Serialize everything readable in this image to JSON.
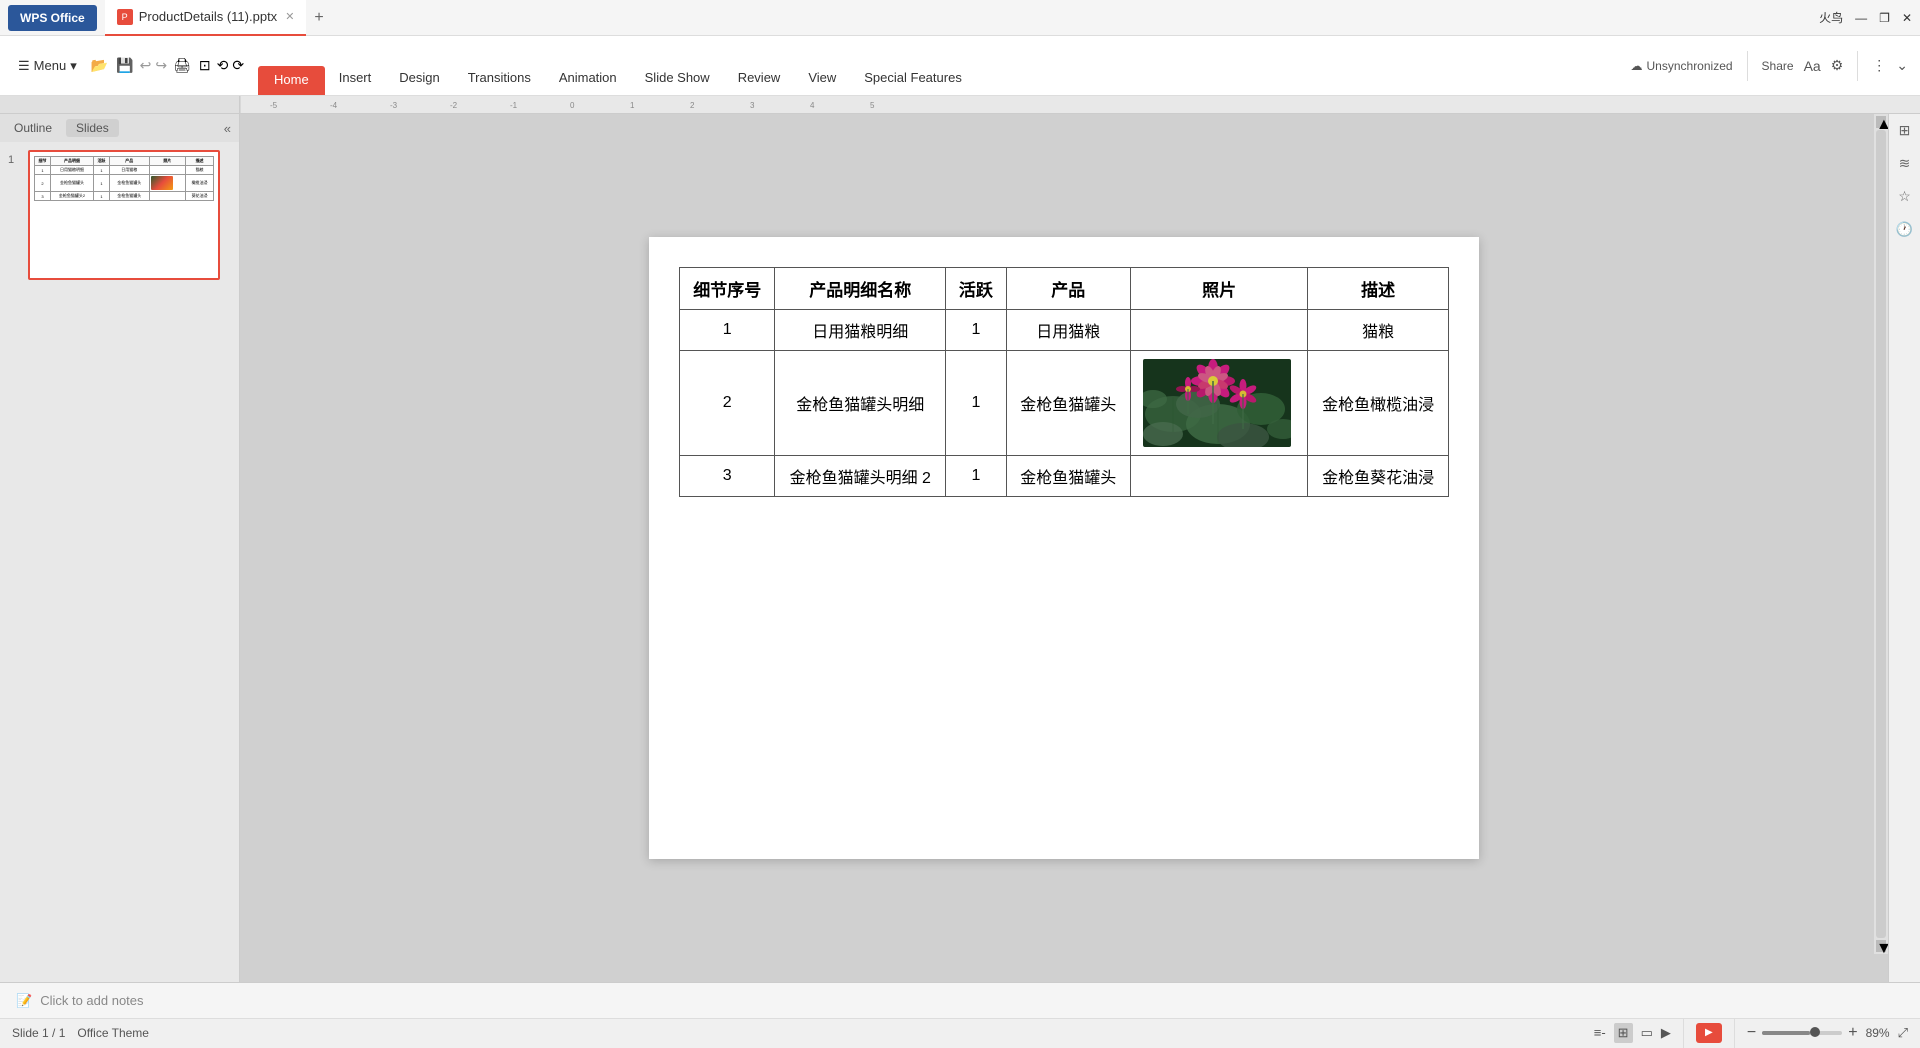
{
  "titleBar": {
    "wpsLabel": "WPS Office",
    "fileName": "ProductDetails (11).pptx",
    "addTabLabel": "+",
    "firebird": "火鸟",
    "unsync": "Unsynchronized",
    "share": "Share",
    "windowControls": [
      "—",
      "❐",
      "✕"
    ]
  },
  "ribbon": {
    "menu": "Menu",
    "tabs": [
      {
        "label": "Home",
        "active": true,
        "style": "home"
      },
      {
        "label": "Insert",
        "active": false
      },
      {
        "label": "Design",
        "active": false
      },
      {
        "label": "Transitions",
        "active": false
      },
      {
        "label": "Animation",
        "active": false
      },
      {
        "label": "Slide Show",
        "active": false
      },
      {
        "label": "Review",
        "active": false
      },
      {
        "label": "View",
        "active": false
      },
      {
        "label": "Special Features",
        "active": false
      }
    ]
  },
  "leftPanel": {
    "tabs": [
      {
        "label": "Outline"
      },
      {
        "label": "Slides",
        "active": true
      }
    ],
    "collapseIcon": "«"
  },
  "slide": {
    "table": {
      "headers": [
        "细节序号",
        "产品明细名称",
        "活跃",
        "产品",
        "照片",
        "描述"
      ],
      "rows": [
        {
          "id": "1",
          "name": "日用猫粮明细",
          "active": "1",
          "product": "日用猫粮",
          "photo": "",
          "description": "猫粮"
        },
        {
          "id": "2",
          "name": "金枪鱼猫罐头明细",
          "active": "1",
          "product": "金枪鱼猫罐头",
          "photo": "lotus",
          "description": "金枪鱼橄榄油浸"
        },
        {
          "id": "3",
          "name": "金枪鱼猫罐头明细 2",
          "active": "1",
          "product": "金枪鱼猫罐头",
          "photo": "",
          "description": "金枪鱼葵花油浸"
        }
      ]
    }
  },
  "notes": {
    "icon": "📝",
    "placeholder": "Click to add notes"
  },
  "statusBar": {
    "slideInfo": "Slide 1 / 1",
    "theme": "Office Theme",
    "zoom": "89%",
    "viewIcons": [
      "≡",
      "⊞",
      "▭",
      "▶"
    ]
  }
}
